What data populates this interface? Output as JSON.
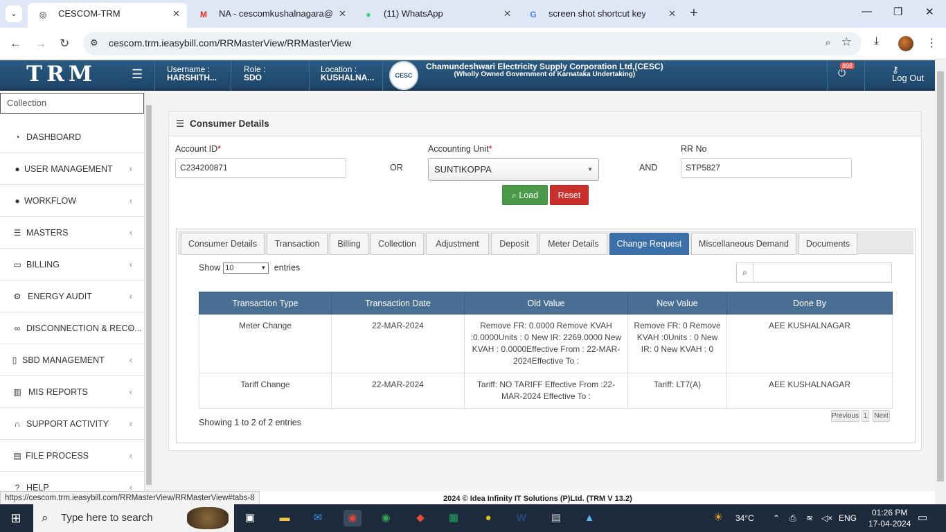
{
  "browser": {
    "tabs": [
      {
        "title": "CESCOM-TRM",
        "icon": "globe-icon"
      },
      {
        "title": "NA - cescomkushalnagara@gm",
        "icon": "gmail-icon"
      },
      {
        "title": "(11) WhatsApp",
        "icon": "whatsapp-icon"
      },
      {
        "title": "screen shot shortcut key in wind",
        "icon": "google-icon"
      }
    ],
    "url": "cescom.trm.ieasybill.com/RRMasterView/RRMasterView",
    "status_url": "https://cescom.trm.ieasybill.com/RRMasterView/RRMasterView#tabs-8"
  },
  "header": {
    "logo": "TRM",
    "username_label": "Username :",
    "username": "HARSHITH...",
    "role_label": "Role :",
    "role": "SDO",
    "location_label": "Location :",
    "location": "KUSHALNA...",
    "org_name": "Chamundeshwari Electricity Supply Corporation Ltd,(CESC)",
    "org_sub": "(Wholly Owned Government of Karnataka Undertaking)",
    "seal_text": "CESC",
    "notif_count": "898",
    "logout_label": "Log Out"
  },
  "sidebar": {
    "search_value": "Collection",
    "items": [
      {
        "label": "DASHBOARD",
        "icon": "dashboard-icon",
        "arrow": ""
      },
      {
        "label": "USER MANAGEMENT",
        "icon": "user-icon",
        "arrow": "‹"
      },
      {
        "label": "WORKFLOW",
        "icon": "user-icon",
        "arrow": "‹"
      },
      {
        "label": "MASTERS",
        "icon": "list-icon",
        "arrow": "‹"
      },
      {
        "label": "BILLING",
        "icon": "monitor-icon",
        "arrow": "‹"
      },
      {
        "label": "ENERGY AUDIT",
        "icon": "gears-icon",
        "arrow": "‹"
      },
      {
        "label": "DISCONNECTION & RECO...",
        "icon": "link-icon",
        "arrow": "‹"
      },
      {
        "label": "SBD MANAGEMENT",
        "icon": "mobile-icon",
        "arrow": "‹"
      },
      {
        "label": "MIS REPORTS",
        "icon": "bar-chart-icon",
        "arrow": "‹"
      },
      {
        "label": "SUPPORT ACTIVITY",
        "icon": "headset-icon",
        "arrow": "‹"
      },
      {
        "label": "FILE PROCESS",
        "icon": "file-icon",
        "arrow": "‹"
      },
      {
        "label": "HELP",
        "icon": "help-icon",
        "arrow": "‹"
      }
    ]
  },
  "panel": {
    "title": "Consumer Details",
    "account_id_label": "Account ID",
    "account_id": "C234200871",
    "or": "OR",
    "acct_unit_label": "Accounting Unit",
    "acct_unit": "SUNTIKOPPA",
    "and": "AND",
    "rr_label": "RR No",
    "rr_no": "STP5827",
    "load_label": "Load",
    "reset_label": "Reset"
  },
  "tabs": [
    "Consumer Details",
    "Transaction",
    "Billing",
    "Collection",
    "Adjustment",
    "Deposit",
    "Meter Details",
    "Change Request",
    "Miscellaneous Demand",
    "Documents"
  ],
  "active_tab": "Change Request",
  "table": {
    "show_label": "Show",
    "entries_value": "10",
    "entries_label": "entries",
    "columns": [
      "Transaction Type",
      "Transaction Date",
      "Old Value",
      "New Value",
      "Done By"
    ],
    "rows": [
      [
        "Meter Change",
        "22-MAR-2024",
        "Remove FR: 0.0000 Remove KVAH :0.0000Units : 0 New IR: 2269.0000 New KVAH : 0.0000Effective From : 22-MAR-2024Effective To :",
        "Remove FR: 0 Remove KVAH :0Units : 0 New IR: 0 New KVAH : 0",
        "AEE KUSHALNAGAR"
      ],
      [
        "Tariff Change",
        "22-MAR-2024",
        "Tariff: NO TARIFF Effective From :22-MAR-2024 Effective To :",
        "Tariff: LT7(A)",
        "AEE KUSHALNAGAR"
      ]
    ],
    "info": "Showing 1 to 2 of 2 entries",
    "prev": "Previous",
    "page": "1",
    "next": "Next"
  },
  "footer": "2024 © Idea Infinity IT Solutions (P)Ltd. (TRM V 13.2)",
  "taskbar": {
    "search_placeholder": "Type here to search",
    "weather": "34°C",
    "lang": "ENG",
    "time": "01:26 PM",
    "date": "17-04-2024"
  },
  "colors": {
    "header": "#1e4568",
    "active_tab": "#3a6fa8",
    "load_btn": "#4a9a4a",
    "reset_btn": "#c9302c",
    "table_head": "#4a6f94"
  }
}
